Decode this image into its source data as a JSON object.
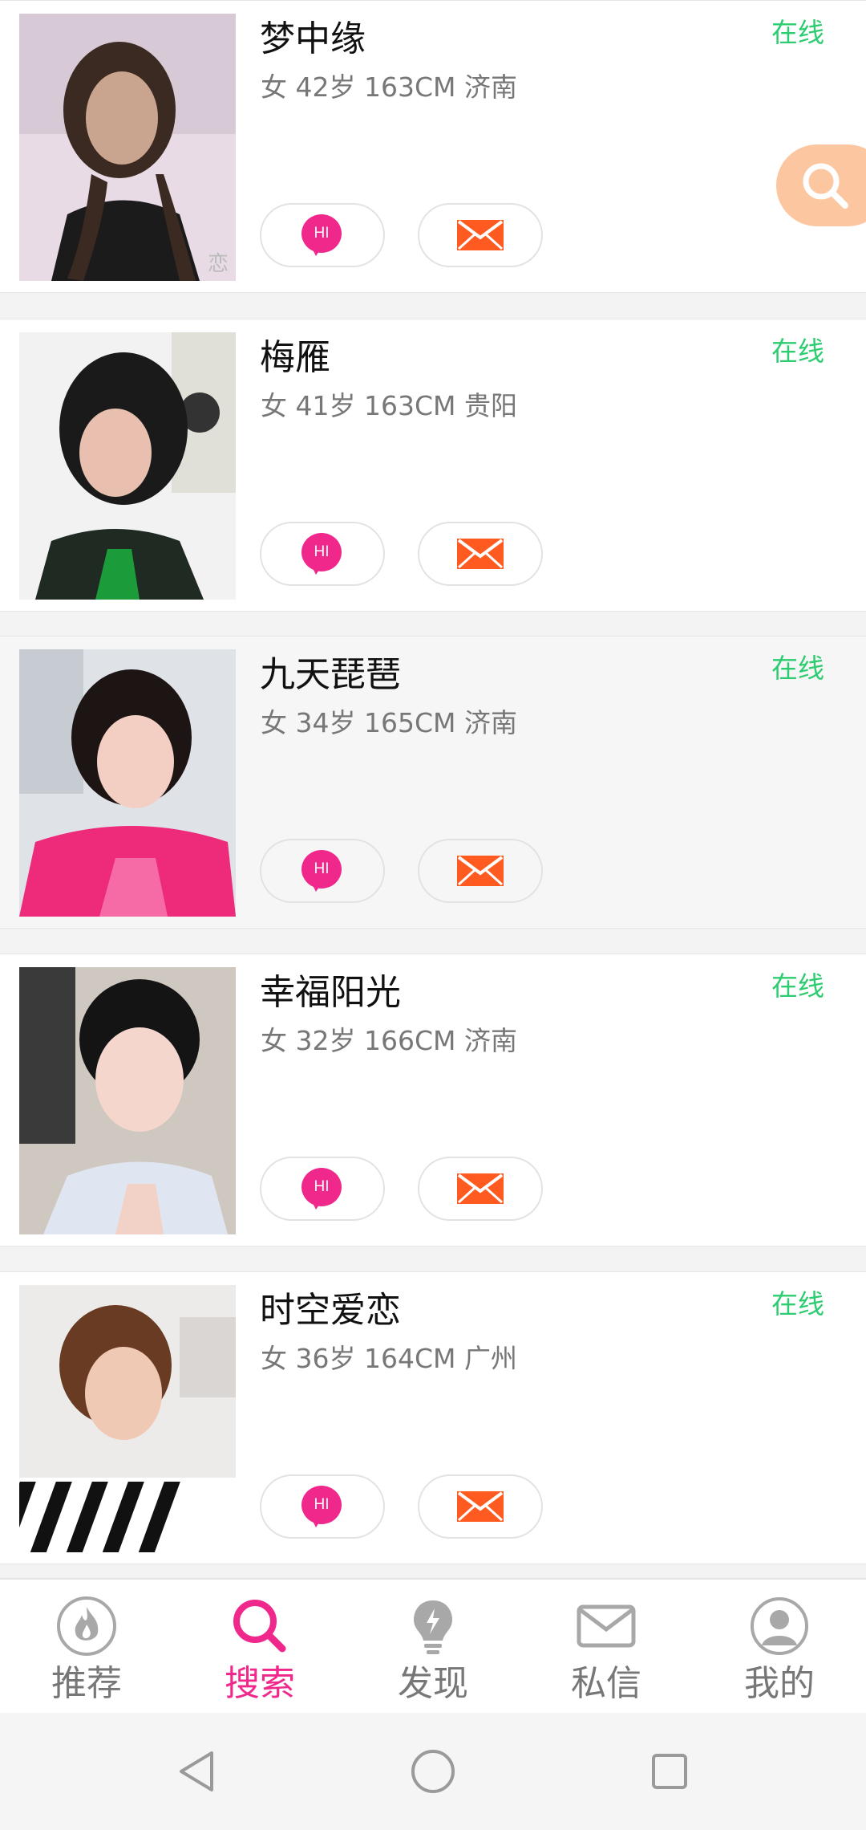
{
  "users": [
    {
      "name": "梦中缘",
      "info": "女 42岁 163CM 济南",
      "status": "在线",
      "hi_label": "HI"
    },
    {
      "name": "梅雁",
      "info": "女 41岁 163CM 贵阳",
      "status": "在线",
      "hi_label": "HI"
    },
    {
      "name": "九天琵琶",
      "info": "女 34岁 165CM 济南",
      "status": "在线",
      "hi_label": "HI"
    },
    {
      "name": "幸福阳光",
      "info": "女 32岁 166CM 济南",
      "status": "在线",
      "hi_label": "HI"
    },
    {
      "name": "时空爱恋",
      "info": "女 36岁 164CM 广州",
      "status": "在线",
      "hi_label": "HI"
    }
  ],
  "nav": {
    "items": [
      {
        "label": "推荐",
        "icon": "flame-icon"
      },
      {
        "label": "搜索",
        "icon": "search-icon",
        "active": true
      },
      {
        "label": "发现",
        "icon": "lightbulb-icon"
      },
      {
        "label": "私信",
        "icon": "mail-icon"
      },
      {
        "label": "我的",
        "icon": "profile-icon"
      }
    ]
  },
  "colors": {
    "accent": "#f0288c",
    "online": "#2ecc71",
    "mail_icon": "#ff5a1f",
    "fab": "#fcc7a0",
    "inactive": "#999999"
  }
}
